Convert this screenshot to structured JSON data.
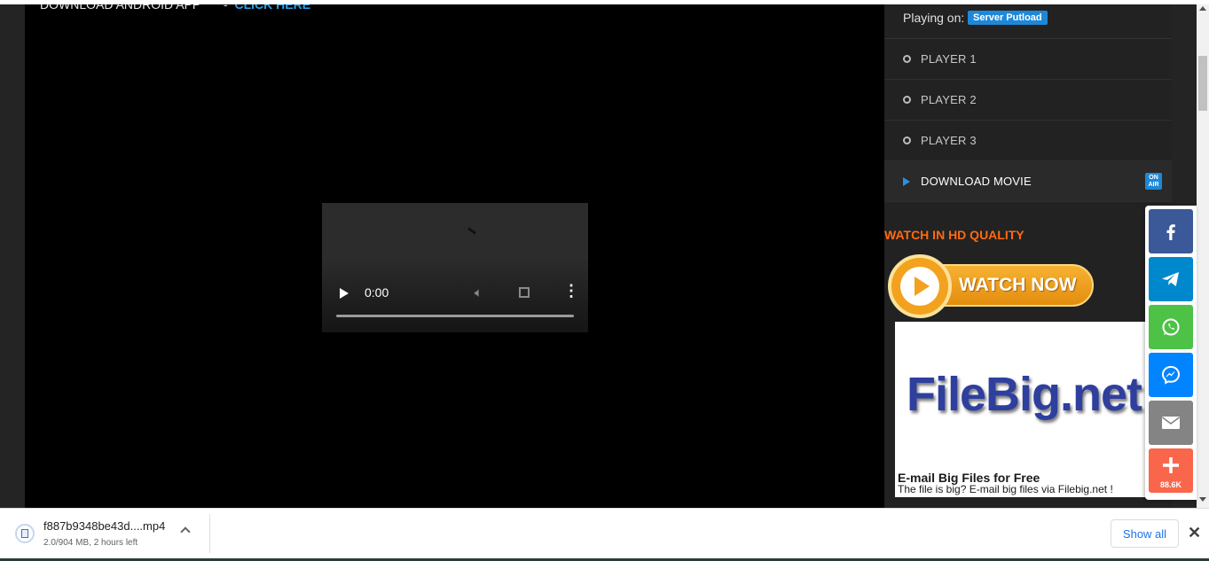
{
  "header": {
    "android_text": "DOWNLOAD ANDROID APP",
    "separator": "-",
    "android_link": "CLICK HERE"
  },
  "video": {
    "time": "0:00",
    "progress": 0
  },
  "sidebar": {
    "playing_on_label": "Playing on:",
    "server": "Server Putload",
    "players": [
      "PLAYER 1",
      "PLAYER 2",
      "PLAYER 3"
    ],
    "download_label": "DOWNLOAD MOVIE",
    "on_air_line1": "ON",
    "on_air_line2": "AIR",
    "hd_title": "WATCH IN HD QUALITY",
    "watch_now": "WATCH NOW",
    "ad": {
      "logo": "FileBig.net",
      "headline": "E-mail Big Files for Free",
      "subtext": "The file is big? E-mail big files via Filebig.net !"
    }
  },
  "share": {
    "count": "88.6K",
    "colors": {
      "facebook": "#3b5998",
      "telegram": "#0088cc",
      "whatsapp": "#4dc247",
      "messenger": "#0084ff",
      "email": "#848484",
      "more": "#f9664b"
    }
  },
  "download_bar": {
    "file_name": "f887b9348be43d....mp4",
    "status": "2.0/904 MB, 2 hours left",
    "show_all": "Show all",
    "close": "✕"
  }
}
